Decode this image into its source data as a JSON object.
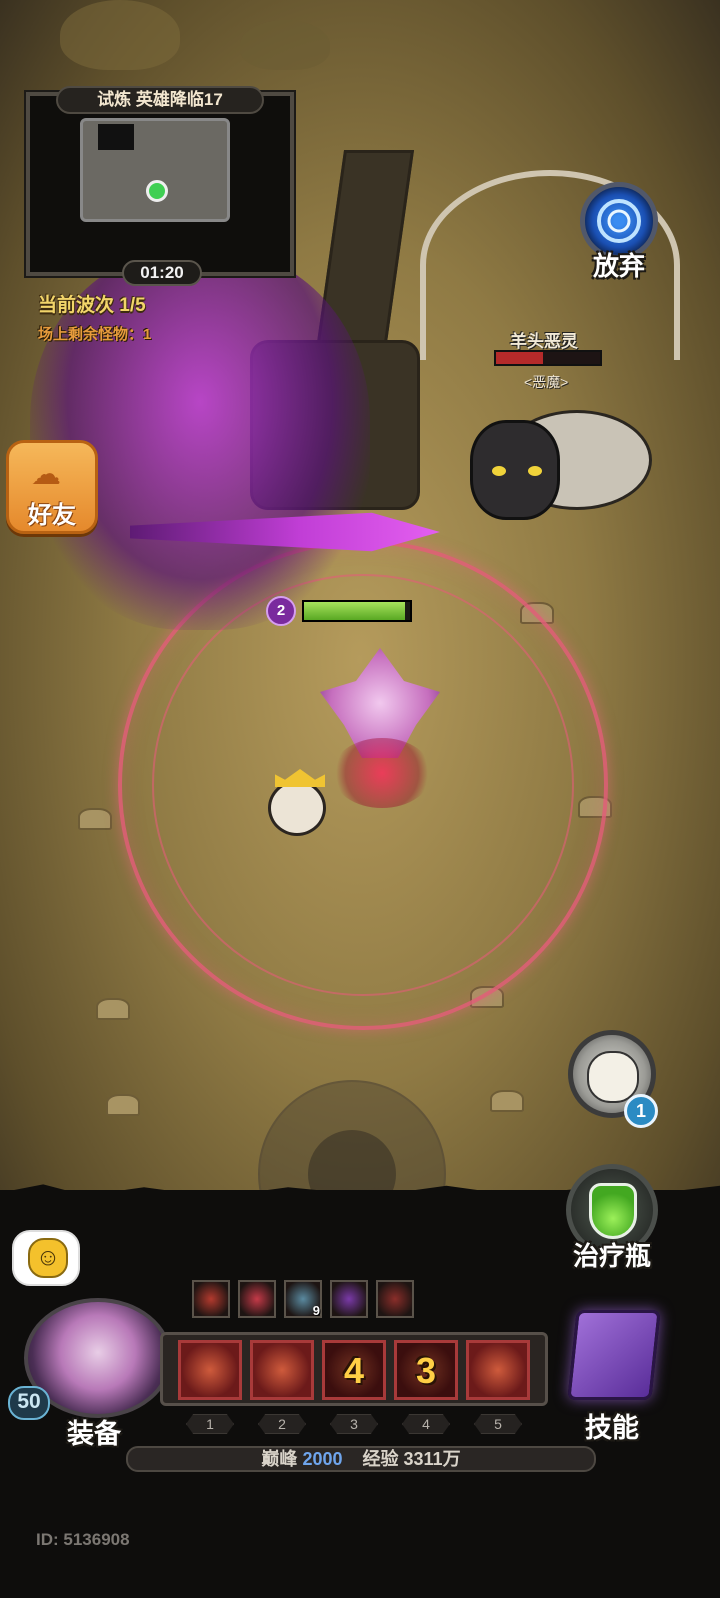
{
  "minimap": {
    "title": "试炼 英雄降临17",
    "timer": "01:20"
  },
  "wave": {
    "current_label": "当前波次 1/5",
    "remaining_label": "场上剩余怪物：1"
  },
  "buttons": {
    "give_up": "放弃",
    "friends": "好友",
    "potion": "治疗瓶",
    "equipment": "装备",
    "skills": "技能"
  },
  "enemy": {
    "name": "羊头恶灵",
    "type": "<恶魔>",
    "hp_fraction": 0.45
  },
  "hero": {
    "level_badge": "2",
    "hp_fraction": 0.95
  },
  "summon": {
    "count": "1"
  },
  "player": {
    "level": "50",
    "id_label": "ID: 5136908"
  },
  "buffs": [
    {
      "icon": "sword-buff-icon",
      "color": "#b33a2e",
      "count": ""
    },
    {
      "icon": "slash-buff-icon",
      "color": "#c43a48",
      "count": ""
    },
    {
      "icon": "cat-buff-icon",
      "color": "#5a8aa0",
      "count": "9"
    },
    {
      "icon": "dark-buff-icon",
      "color": "#7a3aa8",
      "count": ""
    },
    {
      "icon": "cycle-buff-icon",
      "color": "#8a2e2a",
      "count": ""
    }
  ],
  "skills": [
    {
      "slot": "1",
      "icon": "fireball-skill-icon",
      "cooldown": ""
    },
    {
      "slot": "2",
      "icon": "flame-skill-icon",
      "cooldown": ""
    },
    {
      "slot": "3",
      "icon": "shadow-skill-icon",
      "cooldown": "4"
    },
    {
      "slot": "4",
      "icon": "blade-skill-icon",
      "cooldown": "3"
    },
    {
      "slot": "5",
      "icon": "burst-skill-icon",
      "cooldown": ""
    }
  ],
  "progress": {
    "peak_label": "巅峰",
    "peak_value": "2000",
    "exp_label": "经验",
    "exp_value": "3311万"
  },
  "colors": {
    "gold_text": "#f2d56a",
    "orange_text": "#e79b3c",
    "magic_circle": "#e25e78",
    "hp_green": "#59a823",
    "enemy_hp_red": "#b42a2a"
  }
}
